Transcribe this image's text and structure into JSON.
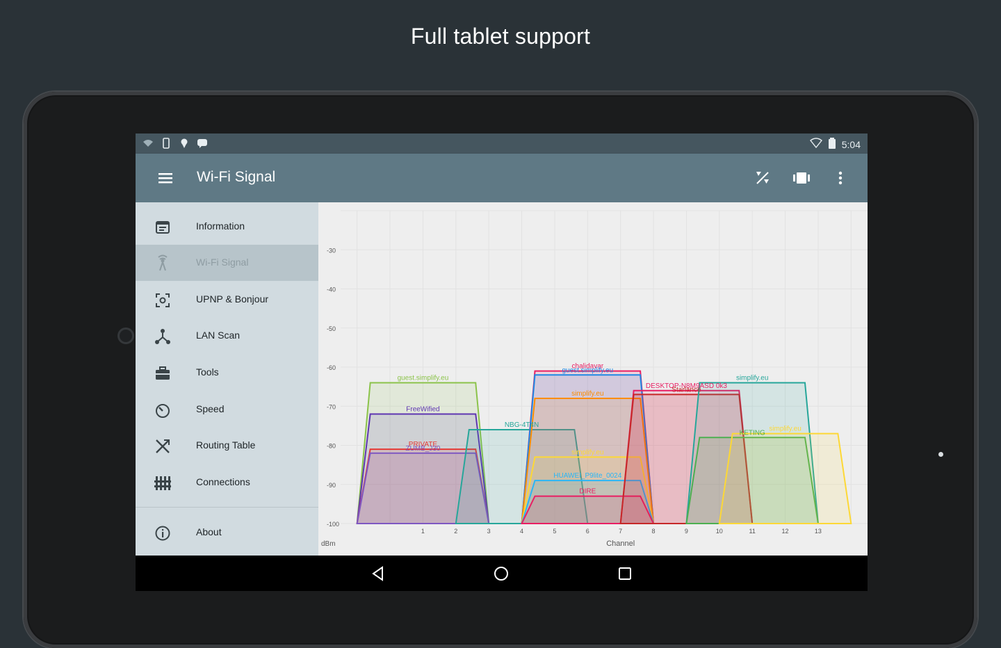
{
  "headline": "Full tablet support",
  "status_bar": {
    "time": "5:04"
  },
  "app_bar": {
    "title": "Wi-Fi Signal"
  },
  "drawer": {
    "items": [
      {
        "label": "Information",
        "icon": "calendar-icon",
        "active": false
      },
      {
        "label": "Wi-Fi Signal",
        "icon": "antenna-icon",
        "active": true
      },
      {
        "label": "UPNP & Bonjour",
        "icon": "scan-icon",
        "active": false
      },
      {
        "label": "LAN Scan",
        "icon": "network-icon",
        "active": false
      },
      {
        "label": "Tools",
        "icon": "toolbox-icon",
        "active": false
      },
      {
        "label": "Speed",
        "icon": "speedometer-icon",
        "active": false
      },
      {
        "label": "Routing Table",
        "icon": "routing-icon",
        "active": false
      },
      {
        "label": "Connections",
        "icon": "connections-icon",
        "active": false
      }
    ],
    "about_label": "About"
  },
  "colors": {
    "accent": "#5f7985",
    "status": "#45565f",
    "drawer": "#d1dbe0"
  },
  "chart_data": {
    "type": "area",
    "xlabel": "Channel",
    "ylabel": "dBm",
    "x_ticks": [
      1,
      2,
      3,
      4,
      5,
      6,
      7,
      8,
      9,
      10,
      11,
      12,
      13
    ],
    "y_ticks": [
      -30,
      -40,
      -50,
      -60,
      -70,
      -80,
      -90,
      -100
    ],
    "xlim": [
      -1.5,
      14.5
    ],
    "ylim": [
      -100,
      -20
    ],
    "series": [
      {
        "name": "guest.simplify.eu",
        "channel": 1,
        "dbm": -64,
        "color": "#8bc34a"
      },
      {
        "name": "FreeWified",
        "channel": 1,
        "dbm": -72,
        "color": "#5e35b1"
      },
      {
        "name": "PRIVATE",
        "channel": 1,
        "dbm": -81,
        "color": "#e53935"
      },
      {
        "name": "ZUMB_J30",
        "channel": 1,
        "dbm": -82,
        "color": "#7e57c2"
      },
      {
        "name": "NBG-4T4N",
        "channel": 4,
        "dbm": -76,
        "color": "#26a69a"
      },
      {
        "name": "chalidavar",
        "channel": 6,
        "dbm": -61,
        "color": "#e91e63"
      },
      {
        "name": "guest.simplify.eu",
        "channel": 6,
        "dbm": -62,
        "color": "#1e88e5"
      },
      {
        "name": "simplify.eu",
        "channel": 6,
        "dbm": -68,
        "color": "#fb8c00"
      },
      {
        "name": "simplify.eu",
        "channel": 6,
        "dbm": -83,
        "color": "#fdd835"
      },
      {
        "name": "HUAWEI_P9lite_0024",
        "channel": 6,
        "dbm": -89,
        "color": "#29b6f6"
      },
      {
        "name": "DIRE",
        "channel": 6,
        "dbm": -93,
        "color": "#e91e63"
      },
      {
        "name": "DESKTOP-N8M9ASD 0k3",
        "channel": 9,
        "dbm": -66,
        "color": "#e91e63"
      },
      {
        "name": "Starlance",
        "channel": 9,
        "dbm": -67,
        "color": "#c62828"
      },
      {
        "name": "simplify.eu",
        "channel": 11,
        "dbm": -64,
        "color": "#26a69a"
      },
      {
        "name": "KETING",
        "channel": 11,
        "dbm": -78,
        "color": "#4caf50"
      },
      {
        "name": "simplify.eu",
        "channel": 12,
        "dbm": -77,
        "color": "#fdd835"
      }
    ]
  }
}
